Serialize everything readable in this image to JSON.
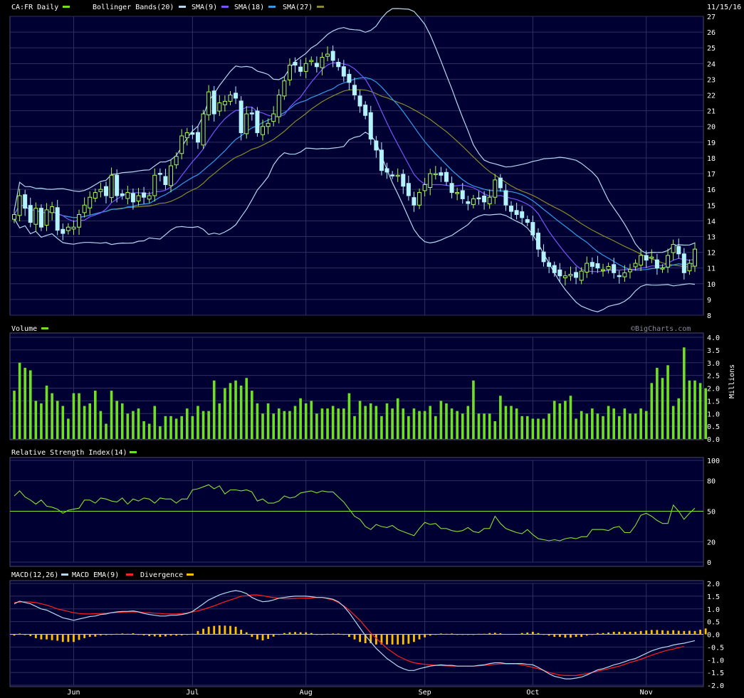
{
  "header": {
    "symbol_label": "CA:FR Daily",
    "date": "11/15/16",
    "copyright": "©BigCharts.com"
  },
  "legends": {
    "price": [
      {
        "name": "Bollinger Bands(20)",
        "color": "#b4d8f0"
      },
      {
        "name": "SMA(9)",
        "color": "#7a52ff"
      },
      {
        "name": "SMA(18)",
        "color": "#2f9cf0"
      },
      {
        "name": "SMA(27)",
        "color": "#8a8a2a"
      }
    ],
    "volume_label": "Volume",
    "volume_unit": "Millions",
    "rsi_label": "Relative Strength Index(14)",
    "macd": [
      {
        "name": "MACD(12,26)",
        "color": "#b4d8f0"
      },
      {
        "name": "MACD EMA(9)",
        "color": "#ff2020"
      },
      {
        "name": "Divergence",
        "color": "#ffc000"
      }
    ]
  },
  "colors": {
    "background": "#000033",
    "grid": "#30305e",
    "up": "#a6ff4d",
    "down": "#b3f3ff",
    "bbands": "#b4d8f0",
    "sma9": "#7a52ff",
    "sma18": "#2f9cf0",
    "sma27": "#8a8a2a",
    "volume": "#6ee022",
    "rsi": "#86e036",
    "macd": "#b4d8f0",
    "signal": "#ff2020",
    "divergence": "#ffc000"
  },
  "chart_data": [
    {
      "type": "candlestick",
      "name": "price",
      "ylim": [
        8,
        27
      ],
      "y_ticks": [
        8,
        9,
        10,
        11,
        12,
        13,
        14,
        15,
        16,
        17,
        18,
        19,
        20,
        21,
        22,
        23,
        24,
        25,
        26,
        27
      ],
      "x_labels": [
        {
          "label": "Jun",
          "index": 11
        },
        {
          "label": "Jul",
          "index": 33
        },
        {
          "label": "Aug",
          "index": 54
        },
        {
          "label": "Sep",
          "index": 76
        },
        {
          "label": "Oct",
          "index": 96
        },
        {
          "label": "Nov",
          "index": 117
        }
      ],
      "close": [
        14.4,
        15.6,
        14.8,
        13.9,
        14.8,
        13.6,
        14.7,
        14.9,
        13.4,
        13.2,
        13.6,
        13.6,
        14.4,
        15,
        15.5,
        15.8,
        16,
        15.6,
        16.9,
        15.6,
        15.6,
        15.8,
        15.2,
        15.6,
        15.5,
        15.6,
        16.9,
        17,
        16.3,
        17.5,
        18.1,
        19.4,
        19.6,
        19.5,
        19,
        20.8,
        22.2,
        20.8,
        21.5,
        21.6,
        22,
        21.8,
        19.6,
        20.8,
        20.8,
        19.6,
        20,
        20.2,
        20.8,
        22,
        22.9,
        23.9,
        23.9,
        23.5,
        24,
        24.2,
        23.8,
        24.4,
        24.6,
        24.2,
        23.8,
        23.2,
        22.8,
        22,
        21.3,
        20.7,
        19.2,
        18.5,
        17.2,
        17.1,
        16.9,
        16.9,
        16.2,
        15.6,
        15,
        15.8,
        16.3,
        17,
        17,
        16.9,
        16.5,
        15.8,
        15.8,
        15.4,
        15.1,
        15.4,
        15.4,
        15.2,
        15.5,
        16.6,
        16.1,
        15,
        14.6,
        14.4,
        14.2,
        13.9,
        13.1,
        12.2,
        11.4,
        11.1,
        10.7,
        10.5,
        10.5,
        10.6,
        10.4,
        10.8,
        11.3,
        11.1,
        11,
        10.9,
        11.1,
        10.7,
        10.5,
        10.7,
        10.9,
        11.3,
        11.8,
        11.5,
        11.7,
        11,
        11,
        11.8,
        12.5,
        11.9,
        10.7,
        11.3,
        12.2
      ],
      "candle_count": 126
    },
    {
      "type": "bar",
      "name": "volume",
      "ylim": [
        0,
        4
      ],
      "y_ticks": [
        0.0,
        0.5,
        1.0,
        1.5,
        2.0,
        2.5,
        3.0,
        3.5,
        4.0
      ],
      "values": [
        1.9,
        3.0,
        2.8,
        2.7,
        1.5,
        1.4,
        2.1,
        1.8,
        1.5,
        1.3,
        0.8,
        1.8,
        1.8,
        1.3,
        1.4,
        1.9,
        1.1,
        0.6,
        1.9,
        1.5,
        1.4,
        1.0,
        1.1,
        1.2,
        0.7,
        0.6,
        1.3,
        0.5,
        0.9,
        0.9,
        0.8,
        0.9,
        1.2,
        0.9,
        1.3,
        1.1,
        1.1,
        2.3,
        1.4,
        2.0,
        2.2,
        2.3,
        2.1,
        2.4,
        1.9,
        1.4,
        1.0,
        1.4,
        1.0,
        1.2,
        1.1,
        1.1,
        1.3,
        1.6,
        1.4,
        1.5,
        1.0,
        1.2,
        1.2,
        1.3,
        1.2,
        1.2,
        1.8,
        0.9,
        1.5,
        1.3,
        1.4,
        1.3,
        0.9,
        1.4,
        1.2,
        1.6,
        1.2,
        0.9,
        1.2,
        1.1,
        1.1,
        1.3,
        0.9,
        1.5,
        1.4,
        1.2,
        1.1,
        1.0,
        1.3,
        2.3,
        1.0,
        1.0,
        1.0,
        0.7,
        1.7,
        1.3,
        1.3,
        1.2,
        0.9,
        0.9,
        0.8,
        0.8,
        0.8,
        1.0,
        1.5,
        1.4,
        1.5,
        1.7,
        0.8,
        1.1,
        1.0,
        1.2,
        1.0,
        0.9,
        1.3,
        1.2,
        0.9,
        1.2,
        1.0,
        1.0,
        1.2,
        1.1,
        2.2,
        2.8,
        2.4,
        2.9,
        1.3,
        1.6,
        3.6,
        2.3,
        2.3,
        2.2,
        2.0
      ],
      "unit": "Millions"
    },
    {
      "type": "line",
      "name": "rsi",
      "ylim": [
        0,
        100
      ],
      "y_ticks": [
        0,
        20,
        50,
        80,
        100
      ],
      "reference_line": 50,
      "values": [
        65,
        70,
        64,
        61,
        57,
        61,
        55,
        54,
        52,
        48,
        51,
        52,
        53,
        61,
        61,
        58,
        63,
        62,
        60,
        59,
        63,
        57,
        62,
        60,
        63,
        62,
        58,
        63,
        62,
        62,
        58,
        62,
        62,
        71,
        72,
        74,
        76,
        72,
        75,
        67,
        71,
        71,
        70,
        71,
        69,
        60,
        62,
        58,
        58,
        60,
        65,
        63,
        64,
        68,
        69,
        70,
        68,
        70,
        69,
        69,
        64,
        59,
        52,
        45,
        42,
        35,
        32,
        37,
        35,
        34,
        36,
        32,
        30,
        28,
        26,
        33,
        39,
        37,
        38,
        33,
        33,
        31,
        30,
        31,
        34,
        30,
        29,
        33,
        33,
        45,
        38,
        33,
        31,
        29,
        28,
        32,
        27,
        23,
        22,
        21,
        22,
        21,
        23,
        24,
        23,
        25,
        25,
        32,
        32,
        32,
        31,
        34,
        35,
        29,
        29,
        36,
        46,
        48,
        45,
        41,
        38,
        38,
        56,
        50,
        42,
        48,
        53
      ]
    },
    {
      "type": "line",
      "name": "macd",
      "ylim": [
        -2,
        2
      ],
      "y_ticks": [
        2.0,
        1.5,
        1.0,
        0.5,
        0.0,
        -0.5,
        -1.0,
        -1.5,
        -2.0
      ],
      "macd": [
        1.2,
        1.3,
        1.25,
        1.2,
        1.1,
        1.0,
        0.95,
        0.85,
        0.75,
        0.65,
        0.6,
        0.55,
        0.6,
        0.65,
        0.7,
        0.72,
        0.78,
        0.8,
        0.85,
        0.88,
        0.9,
        0.9,
        0.92,
        0.88,
        0.82,
        0.78,
        0.75,
        0.72,
        0.72,
        0.75,
        0.75,
        0.78,
        0.82,
        0.9,
        1.05,
        1.2,
        1.35,
        1.45,
        1.55,
        1.62,
        1.68,
        1.72,
        1.68,
        1.6,
        1.45,
        1.35,
        1.28,
        1.3,
        1.35,
        1.42,
        1.45,
        1.48,
        1.5,
        1.5,
        1.5,
        1.48,
        1.45,
        1.45,
        1.42,
        1.38,
        1.28,
        1.1,
        0.85,
        0.55,
        0.25,
        -0.05,
        -0.3,
        -0.55,
        -0.75,
        -0.95,
        -1.1,
        -1.25,
        -1.35,
        -1.42,
        -1.42,
        -1.35,
        -1.3,
        -1.25,
        -1.22,
        -1.2,
        -1.22,
        -1.22,
        -1.25,
        -1.25,
        -1.25,
        -1.25,
        -1.22,
        -1.2,
        -1.15,
        -1.12,
        -1.12,
        -1.15,
        -1.15,
        -1.15,
        -1.15,
        -1.18,
        -1.2,
        -1.3,
        -1.42,
        -1.55,
        -1.65,
        -1.7,
        -1.75,
        -1.75,
        -1.72,
        -1.68,
        -1.6,
        -1.5,
        -1.4,
        -1.35,
        -1.28,
        -1.2,
        -1.15,
        -1.08,
        -1.0,
        -0.95,
        -0.85,
        -0.75,
        -0.65,
        -0.58,
        -0.52,
        -0.48,
        -0.42,
        -0.38,
        -0.35,
        -0.3,
        -0.25
      ],
      "signal": [
        1.25,
        1.27,
        1.28,
        1.27,
        1.25,
        1.2,
        1.15,
        1.08,
        1.0,
        0.95,
        0.9,
        0.85,
        0.82,
        0.8,
        0.8,
        0.81,
        0.82,
        0.83,
        0.85,
        0.86,
        0.87,
        0.88,
        0.88,
        0.88,
        0.86,
        0.85,
        0.83,
        0.82,
        0.8,
        0.8,
        0.8,
        0.82,
        0.84,
        0.88,
        0.92,
        0.98,
        1.05,
        1.12,
        1.2,
        1.28,
        1.35,
        1.42,
        1.5,
        1.52,
        1.55,
        1.55,
        1.52,
        1.48,
        1.44,
        1.42,
        1.4,
        1.4,
        1.41,
        1.42,
        1.42,
        1.43,
        1.45,
        1.45,
        1.4,
        1.35,
        1.25,
        1.12,
        0.95,
        0.75,
        0.55,
        0.3,
        0.05,
        -0.15,
        -0.35,
        -0.55,
        -0.7,
        -0.85,
        -0.95,
        -1.05,
        -1.12,
        -1.15,
        -1.18,
        -1.2,
        -1.22,
        -1.23,
        -1.24,
        -1.25,
        -1.25,
        -1.25,
        -1.25,
        -1.25,
        -1.24,
        -1.22,
        -1.2,
        -1.18,
        -1.16,
        -1.16,
        -1.16,
        -1.16,
        -1.2,
        -1.25,
        -1.3,
        -1.35,
        -1.42,
        -1.5,
        -1.55,
        -1.6,
        -1.62,
        -1.62,
        -1.62,
        -1.58,
        -1.55,
        -1.5,
        -1.45,
        -1.4,
        -1.35,
        -1.3,
        -1.25,
        -1.18,
        -1.1,
        -1.05,
        -0.98,
        -0.9,
        -0.82,
        -0.75,
        -0.68,
        -0.62,
        -0.58,
        -0.52,
        -0.48
      ],
      "divergence": [
        -0.05,
        0.03,
        -0.03,
        -0.07,
        -0.15,
        -0.2,
        -0.2,
        -0.23,
        -0.25,
        -0.3,
        -0.3,
        -0.3,
        -0.22,
        -0.15,
        -0.1,
        -0.09,
        -0.04,
        -0.03,
        0.0,
        0.02,
        0.03,
        0.02,
        0.04,
        0.0,
        -0.04,
        -0.07,
        -0.08,
        -0.1,
        -0.08,
        -0.05,
        -0.05,
        -0.04,
        -0.02,
        0.02,
        0.13,
        0.22,
        0.3,
        0.33,
        0.35,
        0.34,
        0.33,
        0.3,
        0.18,
        0.08,
        -0.1,
        -0.2,
        -0.24,
        -0.18,
        -0.09,
        0.0,
        0.05,
        0.08,
        0.09,
        0.08,
        0.08,
        0.05,
        0.0,
        0.0,
        0.02,
        0.03,
        0.03,
        -0.02,
        -0.1,
        -0.2,
        -0.3,
        -0.35,
        -0.35,
        -0.4,
        -0.4,
        -0.4,
        -0.4,
        -0.4,
        -0.4,
        -0.37,
        -0.3,
        -0.2,
        -0.12,
        -0.05,
        0.0,
        0.03,
        0.02,
        0.03,
        0.0,
        0.0,
        0.0,
        0.0,
        0.02,
        0.02,
        0.05,
        0.06,
        0.04,
        0.01,
        0.01,
        0.01,
        0.05,
        0.07,
        0.1,
        0.05,
        0.0,
        -0.05,
        -0.1,
        -0.1,
        -0.13,
        -0.13,
        -0.1,
        -0.1,
        -0.05,
        0.0,
        0.05,
        0.05,
        0.07,
        0.1,
        0.1,
        0.1,
        0.1,
        0.1,
        0.13,
        0.15,
        0.17,
        0.17,
        0.16,
        0.14,
        0.16,
        0.14,
        0.13,
        0.14,
        0.13,
        0.18,
        0.23
      ]
    }
  ]
}
